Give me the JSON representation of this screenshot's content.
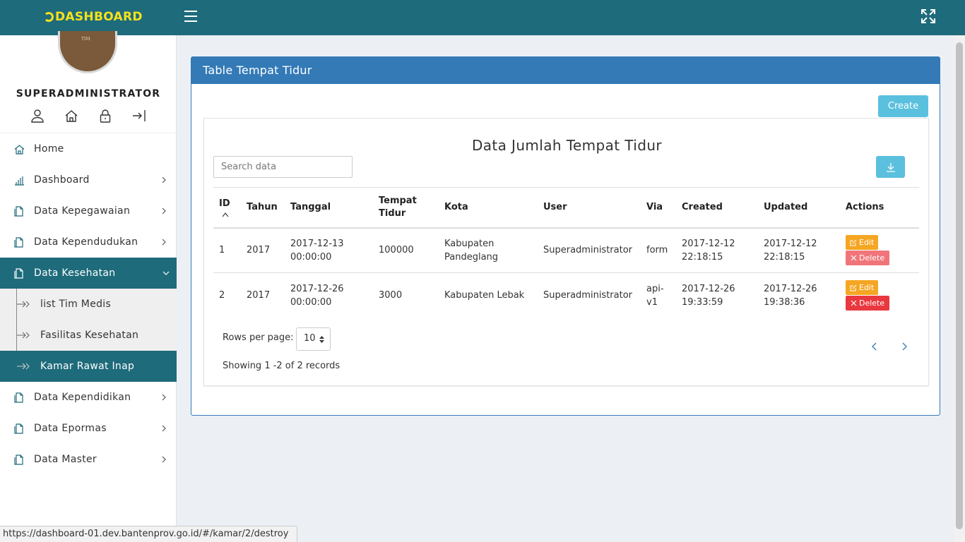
{
  "header": {
    "brand": "DASHBOARD",
    "menu_icon": "hamburger-icon",
    "fullscreen_icon": "fullscreen-icon"
  },
  "user": {
    "avatar_text": "TIM",
    "name": "SUPERADMINISTRATOR",
    "icons": [
      "user-icon",
      "home-icon",
      "lock-icon",
      "logout-icon"
    ]
  },
  "sidebar": {
    "items": [
      {
        "label": "Home",
        "icon": "home-icon"
      },
      {
        "label": "Dashboard",
        "icon": "bar-chart-icon"
      },
      {
        "label": "Data Kepegawaian",
        "icon": "document-icon"
      },
      {
        "label": "Data Kependudukan",
        "icon": "document-icon"
      },
      {
        "label": "Data Kesehatan",
        "icon": "document-icon"
      },
      {
        "label": "Data Kependidikan",
        "icon": "document-icon"
      },
      {
        "label": "Data Epormas",
        "icon": "document-icon"
      },
      {
        "label": "Data Master",
        "icon": "document-icon"
      }
    ],
    "submenu": [
      {
        "label": "list Tim Medis"
      },
      {
        "label": "Fasilitas Kesehatan"
      },
      {
        "label": "Kamar Rawat Inap"
      }
    ]
  },
  "panel": {
    "title": "Table Tempat Tidur",
    "create_label": "Create",
    "card_title": "Data Jumlah Tempat Tidur",
    "search_placeholder": "Search data",
    "columns": [
      "ID",
      "Tahun",
      "Tanggal",
      "Tempat Tidur",
      "Kota",
      "User",
      "Via",
      "Created",
      "Updated",
      "Actions"
    ],
    "rows": [
      {
        "id": "1",
        "tahun": "2017",
        "tanggal": "2017-12-13 00:00:00",
        "tempat_tidur": "100000",
        "kota": "Kabupaten Pandeglang",
        "user": "Superadministrator",
        "via": "form",
        "created": "2017-12-12 22:18:15",
        "updated": "2017-12-12 22:18:15",
        "edit": "Edit",
        "delete": "Delete"
      },
      {
        "id": "2",
        "tahun": "2017",
        "tanggal": "2017-12-26 00:00:00",
        "tempat_tidur": "3000",
        "kota": "Kabupaten Lebak",
        "user": "Superadministrator",
        "via": "api-v1",
        "created": "2017-12-26 19:33:59",
        "updated": "2017-12-26 19:38:36",
        "edit": "Edit",
        "delete": "Delete"
      }
    ],
    "rows_per_page_label": "Rows per page:",
    "rows_per_page_value": "10",
    "showing": "Showing 1 -2 of 2 records"
  },
  "status_url": "https://dashboard-01.dev.bantenprov.go.id/#/kamar/2/destroy",
  "colors": {
    "topbar": "#1e6b7b",
    "brand": "#f5e11d",
    "panel_header": "#337ab7",
    "info_button": "#5bc0de",
    "edit": "#f5a623",
    "delete": "#e9383f"
  }
}
